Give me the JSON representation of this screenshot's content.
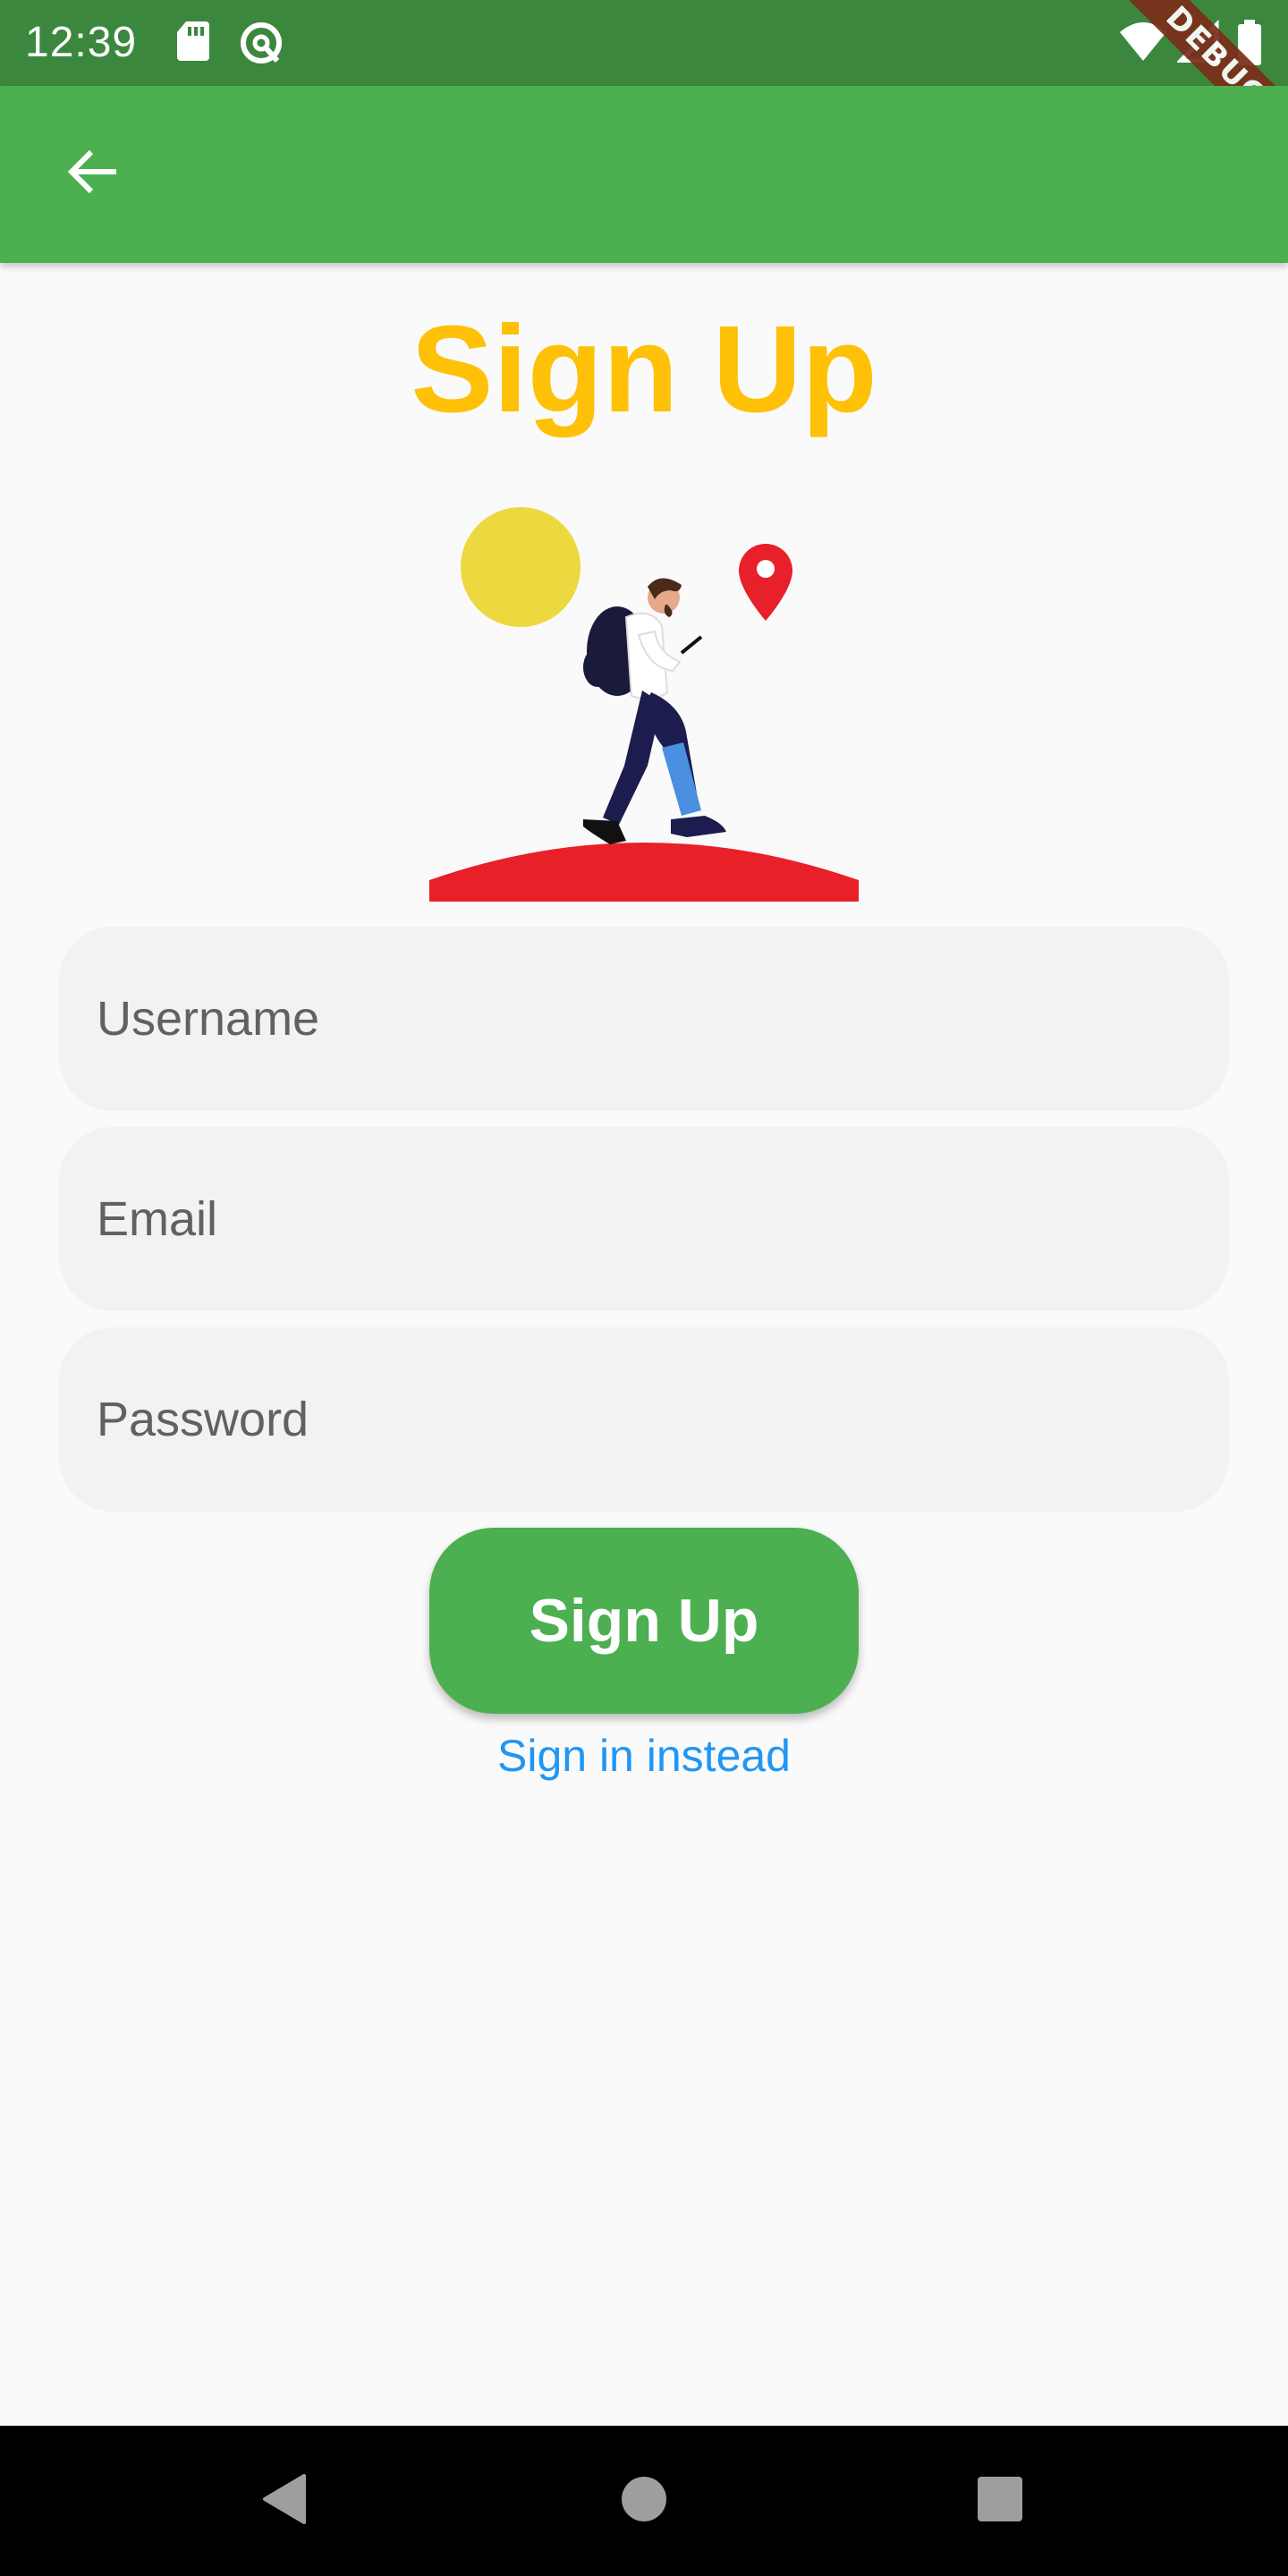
{
  "status_bar": {
    "time": "12:39",
    "icons": [
      "sd-card-icon",
      "sync-icon",
      "wifi-icon",
      "signal-icon",
      "battery-icon"
    ]
  },
  "debug_banner": "DEBUG",
  "app_bar": {
    "back_icon": "arrow-back-icon",
    "color": "#4caf50"
  },
  "page": {
    "title": "Sign Up",
    "title_color": "#ffc107"
  },
  "illustration": {
    "description_icons": [
      "sun-icon",
      "location-pin-icon",
      "hiker-icon",
      "ground-icon"
    ]
  },
  "form": {
    "username_placeholder": "Username",
    "email_placeholder": "Email",
    "password_placeholder": "Password",
    "submit_label": "Sign Up",
    "signin_link": "Sign in instead"
  },
  "nav_bar": {
    "buttons": [
      "back-triangle-icon",
      "home-circle-icon",
      "recents-square-icon"
    ]
  }
}
